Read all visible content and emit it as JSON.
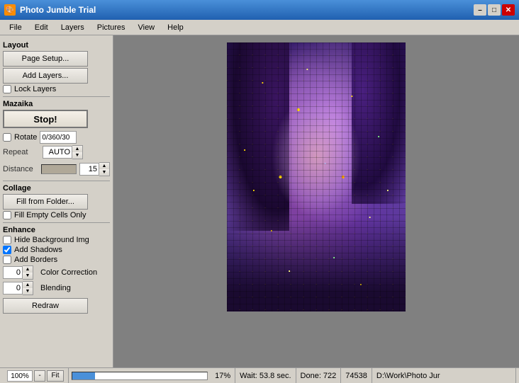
{
  "window": {
    "title": "Photo Jumble Trial",
    "icon": "🎨"
  },
  "titlebar_controls": {
    "minimize": "–",
    "maximize": "□",
    "close": "✕"
  },
  "menubar": {
    "items": [
      "File",
      "Edit",
      "Layers",
      "Pictures",
      "View",
      "Help"
    ]
  },
  "sidebar": {
    "layout_section": "Layout",
    "page_setup_btn": "Page Setup...",
    "add_layers_btn": "Add Layers...",
    "lock_layers_label": "Lock Layers",
    "mazaika_section": "Mazaika",
    "stop_btn": "Stop!",
    "rotate_label": "Rotate",
    "rotate_value": "0/360/30",
    "repeat_label": "Repeat",
    "repeat_value": "AUTO",
    "distance_label": "Distance",
    "distance_value": "15",
    "collage_section": "Collage",
    "fill_from_folder_btn": "Fill from Folder...",
    "fill_empty_label": "Fill Empty Cells Only",
    "enhance_section": "Enhance",
    "hide_bg_label": "Hide Background Img",
    "add_shadows_label": "Add Shadows",
    "add_borders_label": "Add Borders",
    "color_correction_label": "Color Correction",
    "color_correction_value": "0",
    "blending_label": "Blending",
    "blending_value": "0",
    "redraw_btn": "Redraw"
  },
  "statusbar": {
    "zoom_value": "100%",
    "zoom_plus": "+",
    "zoom_minus": "-",
    "fit_label": "Fit",
    "percent": "17%",
    "wait_label": "Wait: 53.8 sec.",
    "done_label": "Done: 722",
    "count": "74538",
    "path": "D:\\Work\\Photo Jur"
  },
  "checkboxes": {
    "lock_layers": false,
    "rotate": false,
    "fill_empty": false,
    "hide_bg": false,
    "add_shadows": true,
    "add_borders": false
  }
}
